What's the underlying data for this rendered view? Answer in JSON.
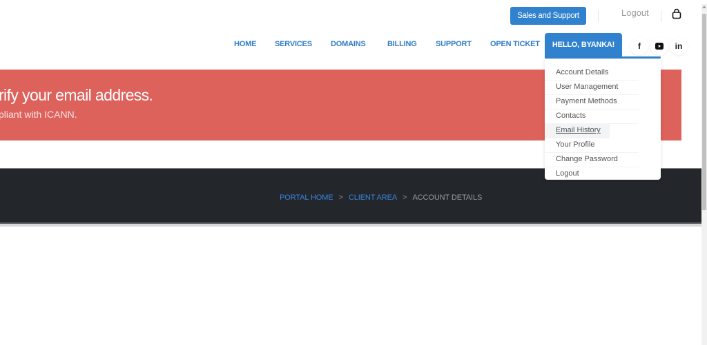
{
  "topbar": {
    "sales_button": "Sales and Support",
    "logout": "Logout",
    "cart_icon": "shopping-bag-icon"
  },
  "nav": {
    "items": [
      {
        "label": "HOME"
      },
      {
        "label": "SERVICES"
      },
      {
        "label": "DOMAINS"
      },
      {
        "label": "BILLING"
      },
      {
        "label": "SUPPORT"
      },
      {
        "label": "OPEN TICKET"
      }
    ],
    "user_menu": "HELLO, BYANKA!",
    "social": [
      {
        "icon": "facebook-icon",
        "glyph": "f"
      },
      {
        "icon": "youtube-icon",
        "glyph": "▶"
      },
      {
        "icon": "linkedin-icon",
        "glyph": "in"
      }
    ]
  },
  "alert": {
    "title": "rify your email address.",
    "subtitle": "pliant with ICANN.",
    "color": "#de625c"
  },
  "breadcrumb": {
    "items": [
      {
        "label": "PORTAL HOME"
      },
      {
        "label": "CLIENT AREA"
      }
    ],
    "separator": ">",
    "current": "ACCOUNT DETAILS"
  },
  "dropdown": {
    "items": [
      {
        "label": "Account Details"
      },
      {
        "label": "User Management"
      },
      {
        "label": "Payment Methods"
      },
      {
        "label": "Contacts"
      },
      {
        "label": "Email History",
        "hovered": true
      },
      {
        "label": "Your Profile"
      },
      {
        "label": "Change Password"
      },
      {
        "label": "Logout"
      }
    ]
  },
  "colors": {
    "accent": "#3182ce",
    "band": "#23262b"
  }
}
